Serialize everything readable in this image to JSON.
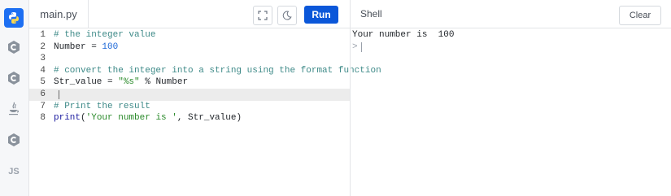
{
  "sidebar": {
    "languages": [
      {
        "name": "python-icon",
        "label": ""
      },
      {
        "name": "c-icon",
        "label": ""
      },
      {
        "name": "cpp-icon",
        "label": ""
      },
      {
        "name": "java-icon",
        "label": ""
      },
      {
        "name": "csharp-icon",
        "label": ""
      },
      {
        "name": "javascript-icon",
        "label": "JS"
      }
    ],
    "active_color": "#1d6ff2"
  },
  "editor": {
    "filename": "main.py",
    "run_label": "Run",
    "lines": [
      {
        "n": "1",
        "comment": "# the integer value"
      },
      {
        "n": "2",
        "var": "Number",
        "op": " = ",
        "num": "100"
      },
      {
        "n": "3"
      },
      {
        "n": "4",
        "comment": "# convert the integer into a string using the format function"
      },
      {
        "n": "5",
        "var": "Str_value",
        "op": " = ",
        "str": "\"%s\"",
        "rest": " % Number"
      },
      {
        "n": "6"
      },
      {
        "n": "7",
        "comment": "# Print the result"
      },
      {
        "n": "8",
        "fn": "print",
        "open": "(",
        "str": "'Your number is '",
        "rest": ", Str_value)"
      }
    ],
    "current_line": "6"
  },
  "shell": {
    "title": "Shell",
    "clear_label": "Clear",
    "output": "Your number is  100",
    "prompt": ">"
  },
  "colors": {
    "run_button": "#0b57d9",
    "comment": "#3e8a88",
    "number": "#1d68d8",
    "string": "#2a8a2a"
  }
}
